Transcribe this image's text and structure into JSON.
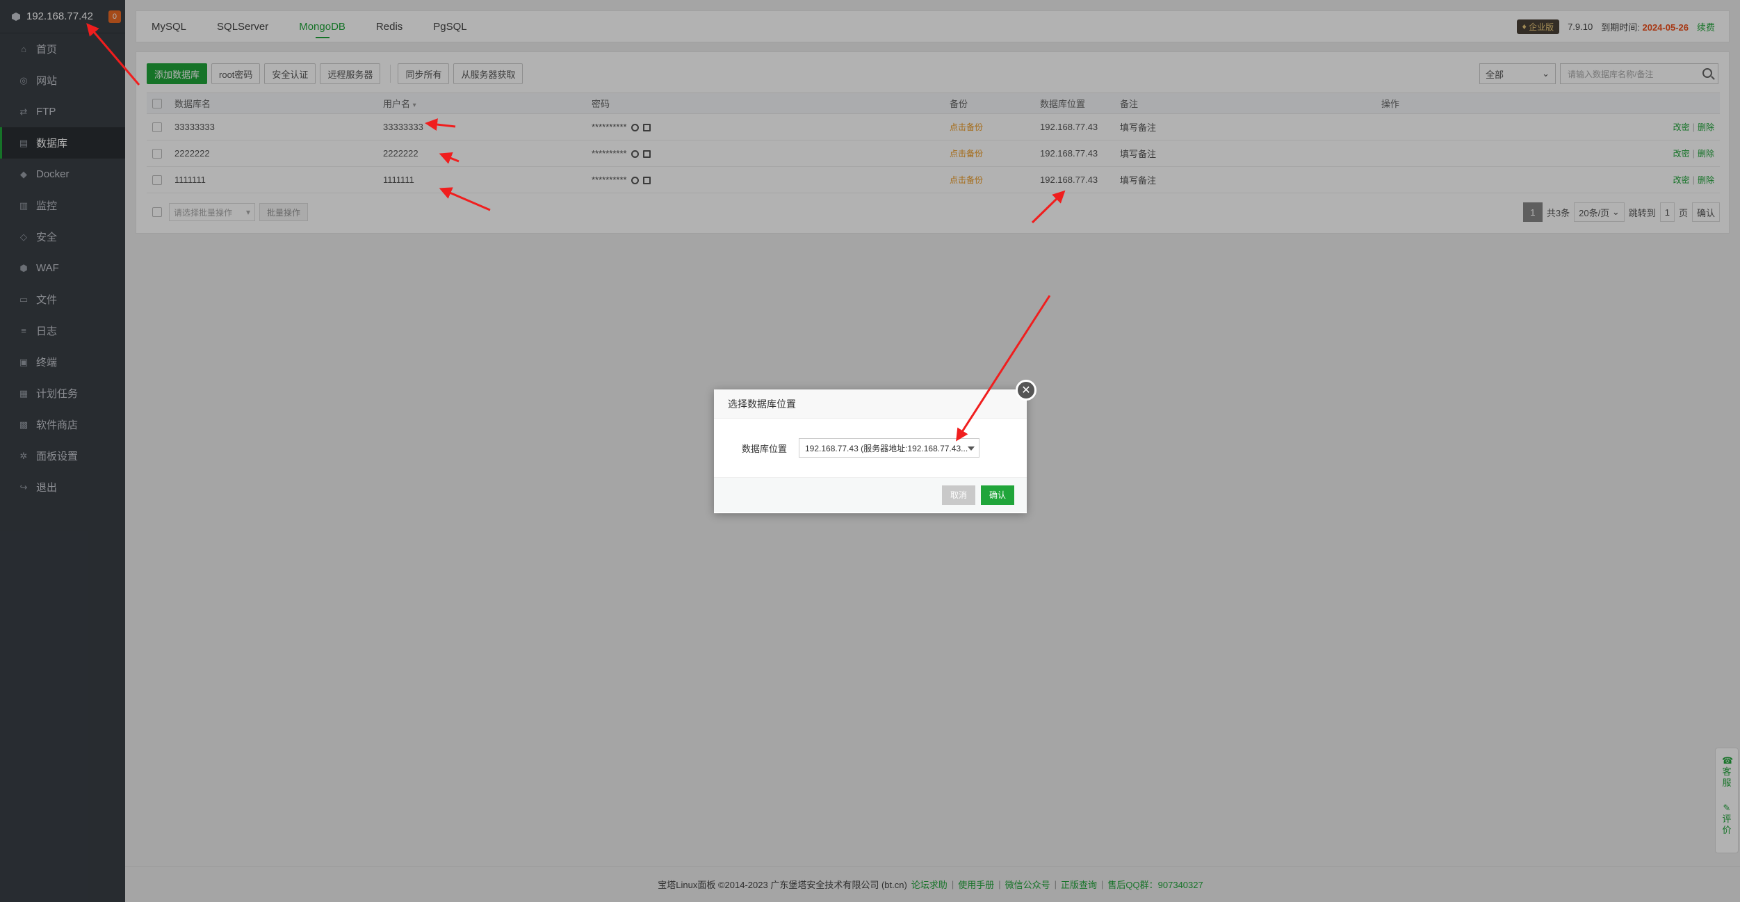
{
  "sidebar": {
    "server_ip": "192.168.77.42",
    "badge": "0",
    "items": [
      {
        "label": "首页",
        "icon": "home-icon"
      },
      {
        "label": "网站",
        "icon": "globe-icon"
      },
      {
        "label": "FTP",
        "icon": "ftp-icon"
      },
      {
        "label": "数据库",
        "icon": "database-icon",
        "active": true
      },
      {
        "label": "Docker",
        "icon": "docker-icon"
      },
      {
        "label": "监控",
        "icon": "monitor-icon"
      },
      {
        "label": "安全",
        "icon": "shield-icon"
      },
      {
        "label": "WAF",
        "icon": "waf-icon"
      },
      {
        "label": "文件",
        "icon": "folder-icon"
      },
      {
        "label": "日志",
        "icon": "log-icon"
      },
      {
        "label": "终端",
        "icon": "terminal-icon"
      },
      {
        "label": "计划任务",
        "icon": "calendar-icon"
      },
      {
        "label": "软件商店",
        "icon": "grid-icon"
      },
      {
        "label": "面板设置",
        "icon": "gear-icon"
      },
      {
        "label": "退出",
        "icon": "logout-icon"
      }
    ]
  },
  "tabs": [
    {
      "label": "MySQL"
    },
    {
      "label": "SQLServer"
    },
    {
      "label": "MongoDB",
      "active": true
    },
    {
      "label": "Redis"
    },
    {
      "label": "PgSQL"
    }
  ],
  "header_right": {
    "edition": "企业版",
    "version": "7.9.10",
    "expire_label": "到期时间:",
    "expire_date": "2024-05-26",
    "renew": "续费"
  },
  "toolbar": {
    "add_db": "添加数据库",
    "root_pwd": "root密码",
    "auth": "安全认证",
    "remote": "远程服务器",
    "sync_all": "同步所有",
    "fetch": "从服务器获取"
  },
  "search": {
    "filter": "全部",
    "placeholder": "请输入数据库名称/备注"
  },
  "table": {
    "headers": {
      "name": "数据库名",
      "user": "用户名",
      "pwd": "密码",
      "backup": "备份",
      "location": "数据库位置",
      "remark": "备注",
      "ops": "操作"
    },
    "rows": [
      {
        "name": "33333333",
        "user": "33333333",
        "pwd": "**********",
        "backup": "点击备份",
        "location": "192.168.77.43",
        "remark": "填写备注",
        "edit": "改密",
        "delete": "删除"
      },
      {
        "name": "2222222",
        "user": "2222222",
        "pwd": "**********",
        "backup": "点击备份",
        "location": "192.168.77.43",
        "remark": "填写备注",
        "edit": "改密",
        "delete": "删除"
      },
      {
        "name": "1111111",
        "user": "1111111",
        "pwd": "**********",
        "backup": "点击备份",
        "location": "192.168.77.43",
        "remark": "填写备注",
        "edit": "改密",
        "delete": "删除"
      }
    ]
  },
  "batch": {
    "select_placeholder": "请选择批量操作",
    "button": "批量操作"
  },
  "pager": {
    "current": "1",
    "total": "共3条",
    "per_page": "20条/页",
    "jump_label": "跳转到",
    "jump_value": "1",
    "page_unit": "页",
    "confirm": "确认"
  },
  "footer": {
    "copyright": "宝塔Linux面板 ©2014-2023 广东堡塔安全技术有限公司 (bt.cn)",
    "links": [
      "论坛求助",
      "使用手册",
      "微信公众号",
      "正版查询",
      "售后QQ群：907340327"
    ]
  },
  "side_help": {
    "service": "客服",
    "review": "评价"
  },
  "modal": {
    "title": "选择数据库位置",
    "label": "数据库位置",
    "value": "192.168.77.43 (服务器地址:192.168.77.43...",
    "cancel": "取消",
    "confirm": "确认"
  },
  "colors": {
    "accent": "#20a53a",
    "annotation": "#f01e1e",
    "expire": "#f0501c"
  }
}
